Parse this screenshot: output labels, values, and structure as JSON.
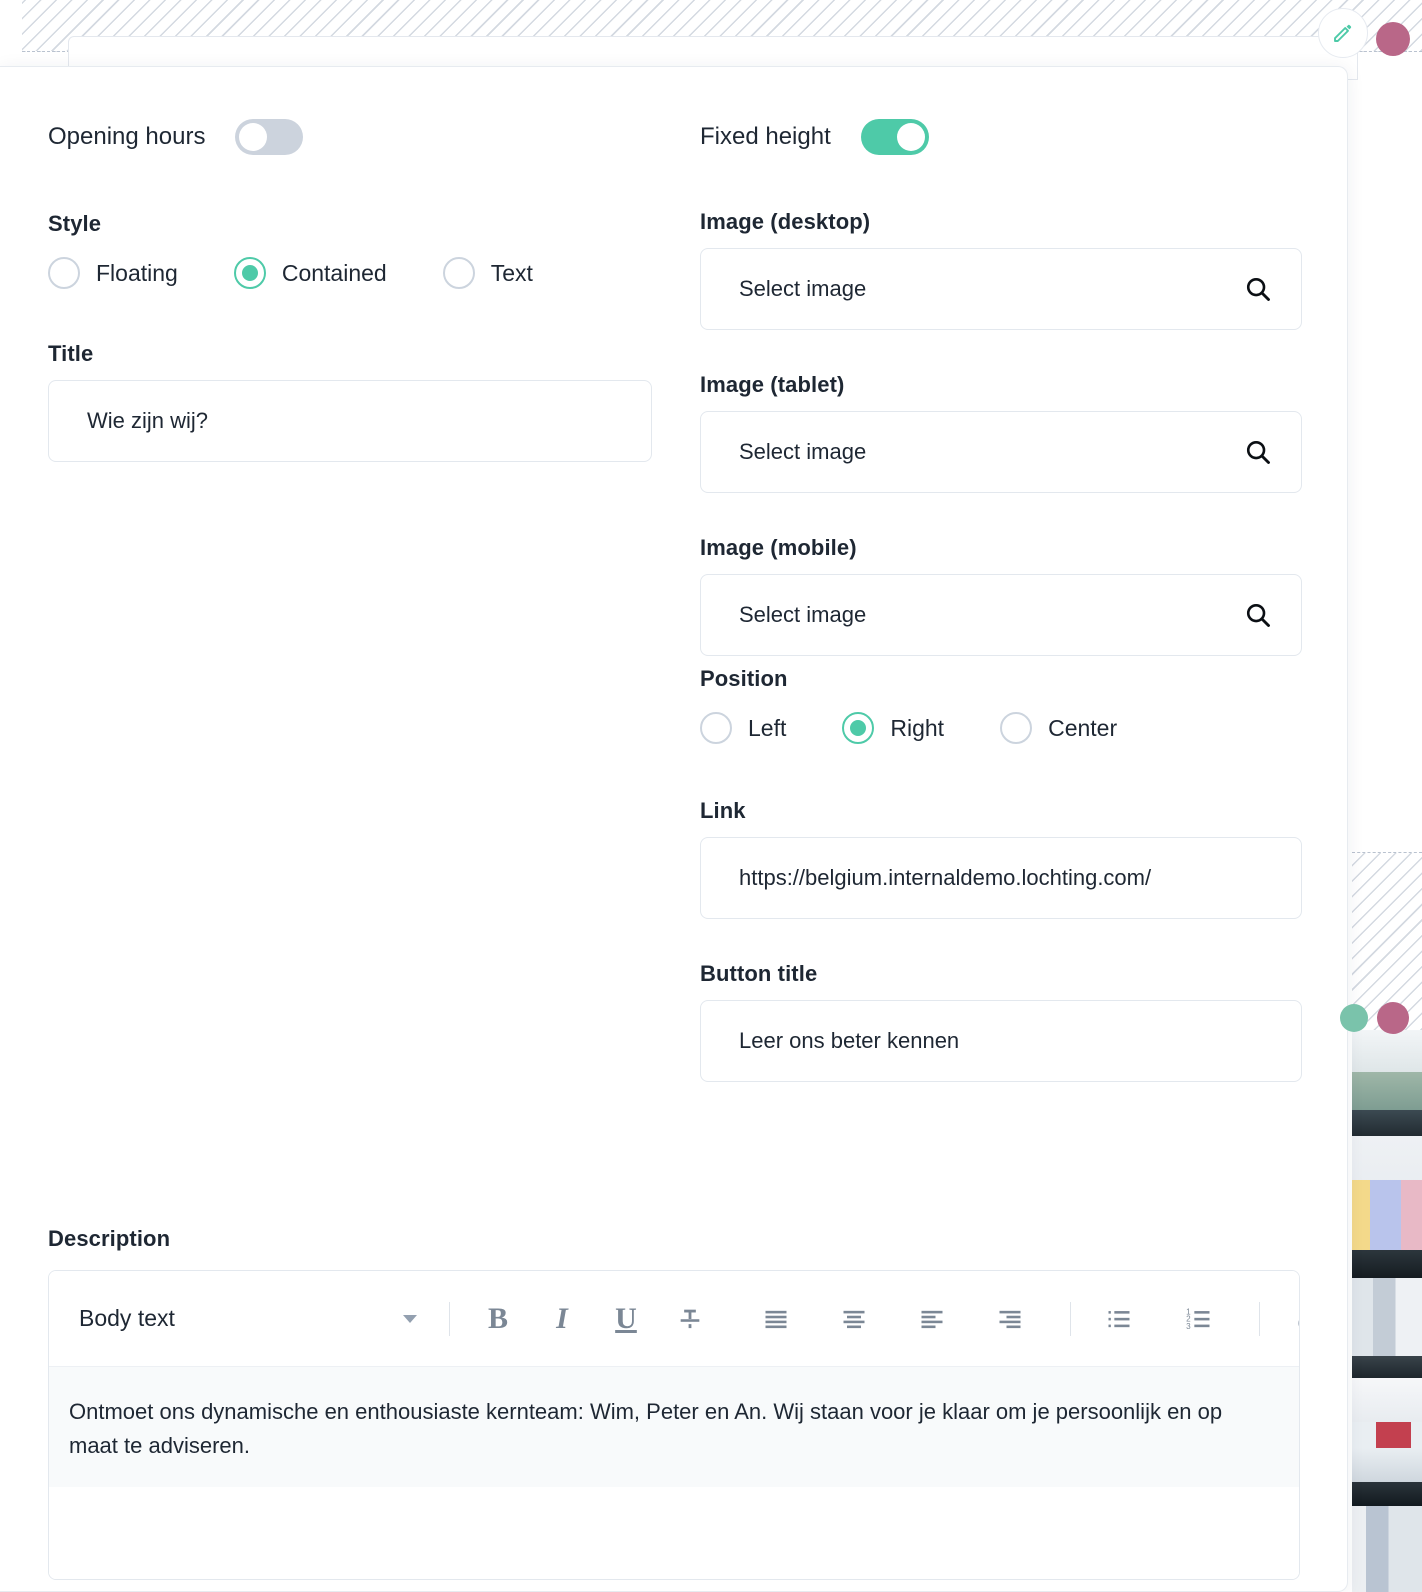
{
  "canvas": {
    "edit_icon": "pencil-icon",
    "handle_dots": [
      "pink-handle",
      "pink-handle",
      "green-handle"
    ]
  },
  "panel": {
    "left_column": {
      "opening_hours": {
        "label": "Opening hours",
        "state": "off",
        "state_label": "Off"
      },
      "style": {
        "label": "Style",
        "selected": "Contained",
        "options": [
          {
            "label": "Floating",
            "selected": false
          },
          {
            "label": "Contained",
            "selected": true
          },
          {
            "label": "Text",
            "selected": false
          }
        ]
      },
      "title": {
        "label": "Title",
        "value": "Wie zijn wij?"
      }
    },
    "right_column": {
      "fixed_height": {
        "label": "Fixed height",
        "state": "on",
        "state_label": "On"
      },
      "image_desktop": {
        "label": "Image (desktop)",
        "value": "Select image",
        "icon": "search-icon"
      },
      "image_tablet": {
        "label": "Image (tablet)",
        "value": "Select image",
        "icon": "search-icon"
      },
      "image_mobile": {
        "label": "Image (mobile)",
        "value": "Select image",
        "icon": "search-icon"
      },
      "position": {
        "label": "Position",
        "selected": "Right",
        "options": [
          {
            "label": "Left",
            "selected": false
          },
          {
            "label": "Right",
            "selected": true
          },
          {
            "label": "Center",
            "selected": false
          }
        ]
      },
      "link": {
        "label": "Link",
        "value": "https://belgium.internaldemo.lochting.com/"
      },
      "button_title": {
        "label": "Button title",
        "value": "Leer ons beter kennen"
      }
    },
    "description": {
      "label": "Description",
      "toolbar": {
        "style_selector": "Body text",
        "buttons": [
          {
            "name": "bold-icon",
            "glyph": "B"
          },
          {
            "name": "italic-icon",
            "glyph": "I"
          },
          {
            "name": "underline-icon",
            "glyph": "U"
          },
          {
            "name": "strikethrough-icon",
            "glyph": "S"
          },
          {
            "name": "align-justify-icon",
            "glyph": ""
          },
          {
            "name": "align-center-icon",
            "glyph": ""
          },
          {
            "name": "align-left-icon",
            "glyph": ""
          },
          {
            "name": "align-right-icon",
            "glyph": ""
          },
          {
            "name": "bullet-list-icon",
            "glyph": ""
          },
          {
            "name": "numbered-list-icon",
            "glyph": ""
          },
          {
            "name": "link-icon",
            "glyph": ""
          }
        ]
      },
      "content": "Ontmoet ons dynamische en enthousiaste kernteam: Wim, Peter en An. Wij staan voor je klaar om je persoonlijk en op maat te adviseren."
    }
  },
  "colors": {
    "accent_green": "#4ecaa8",
    "toggle_off": "#ccd3dd",
    "text_dark": "#1e2733",
    "border": "#e3e8ee",
    "handle_pink": "#b96788",
    "handle_green": "#7ac3ab",
    "editor_body_bg": "#f8fafb"
  }
}
